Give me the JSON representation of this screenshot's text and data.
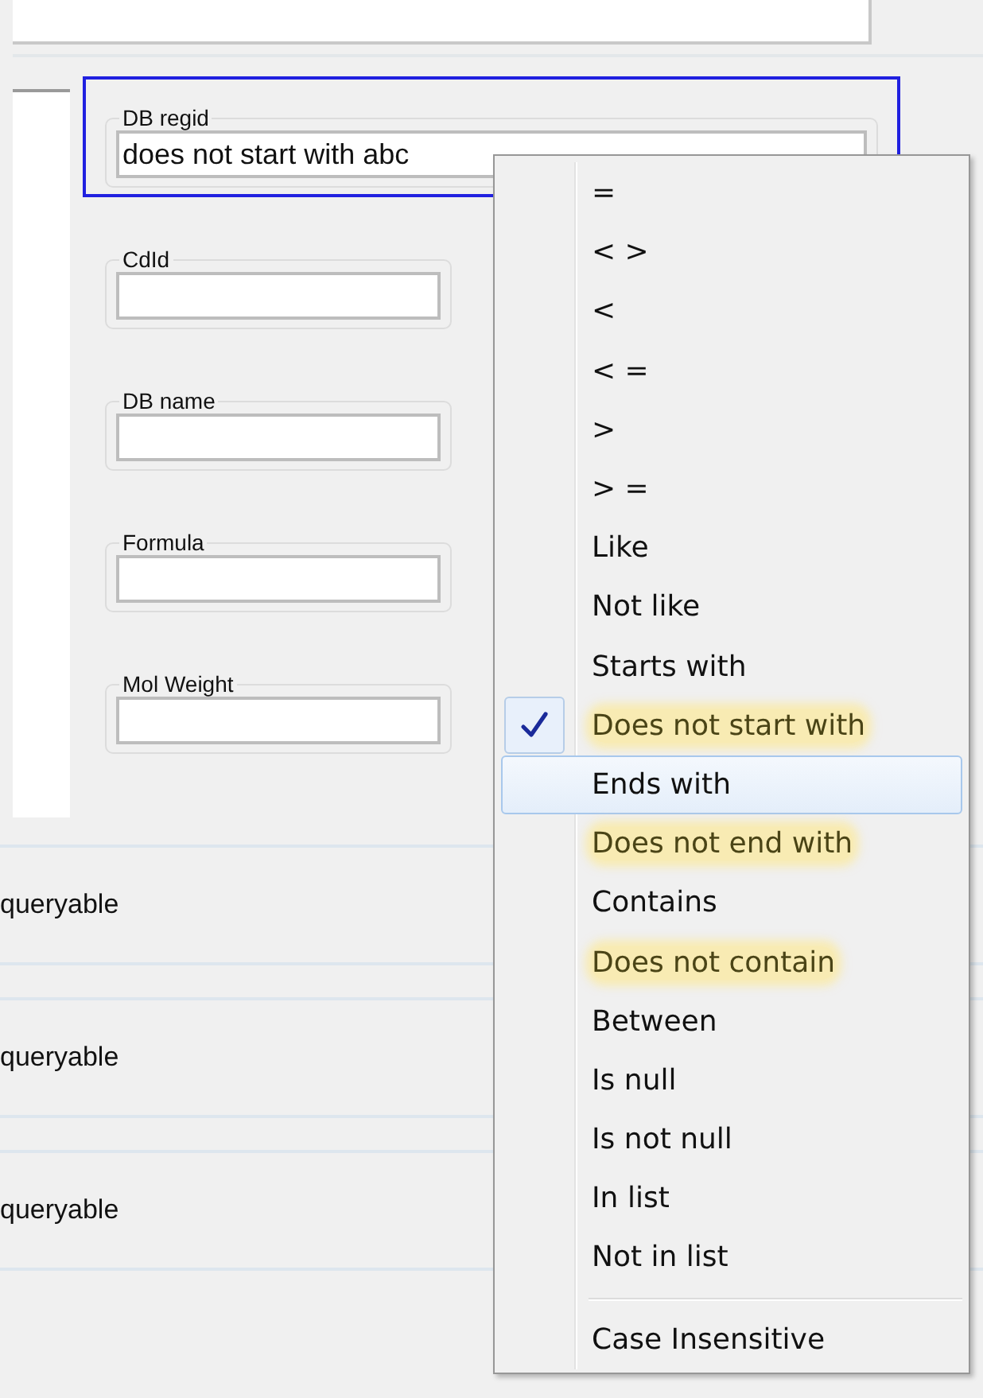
{
  "filter_fields": [
    {
      "label": "DB regid",
      "value": "does not start with abc",
      "focused": true
    },
    {
      "label": "CdId",
      "focused": false
    },
    {
      "label": "DB name",
      "focused": false
    },
    {
      "label": "Formula",
      "focused": false
    },
    {
      "label": "Mol Weight",
      "focused": false
    }
  ],
  "rows": [
    {
      "text": "queryable"
    },
    {
      "text": "queryable"
    },
    {
      "text": "queryable"
    }
  ],
  "operator_menu": {
    "items": [
      {
        "label": "=",
        "checked": false,
        "selected": false,
        "highlighted": false
      },
      {
        "label": "< >",
        "checked": false,
        "selected": false,
        "highlighted": false
      },
      {
        "label": "<",
        "checked": false,
        "selected": false,
        "highlighted": false
      },
      {
        "label": "< =",
        "checked": false,
        "selected": false,
        "highlighted": false
      },
      {
        "label": ">",
        "checked": false,
        "selected": false,
        "highlighted": false
      },
      {
        "label": "> =",
        "checked": false,
        "selected": false,
        "highlighted": false
      },
      {
        "label": "Like",
        "checked": false,
        "selected": false,
        "highlighted": false
      },
      {
        "label": "Not like",
        "checked": false,
        "selected": false,
        "highlighted": false
      },
      {
        "label": "Starts with",
        "checked": false,
        "selected": false,
        "highlighted": false
      },
      {
        "label": "Does not start with",
        "checked": true,
        "selected": false,
        "highlighted": true
      },
      {
        "label": "Ends with",
        "checked": false,
        "selected": true,
        "highlighted": false
      },
      {
        "label": "Does not end with",
        "checked": false,
        "selected": false,
        "highlighted": true
      },
      {
        "label": "Contains",
        "checked": false,
        "selected": false,
        "highlighted": false
      },
      {
        "label": "Does not contain",
        "checked": false,
        "selected": false,
        "highlighted": true
      },
      {
        "label": "Between",
        "checked": false,
        "selected": false,
        "highlighted": false
      },
      {
        "label": "Is null",
        "checked": false,
        "selected": false,
        "highlighted": false
      },
      {
        "label": "Is not null",
        "checked": false,
        "selected": false,
        "highlighted": false
      },
      {
        "label": "In list",
        "checked": false,
        "selected": false,
        "highlighted": false
      },
      {
        "label": "Not in list",
        "checked": false,
        "selected": false,
        "highlighted": false
      }
    ],
    "options": [
      {
        "label": "Case Insensitive",
        "checked": false
      }
    ]
  }
}
